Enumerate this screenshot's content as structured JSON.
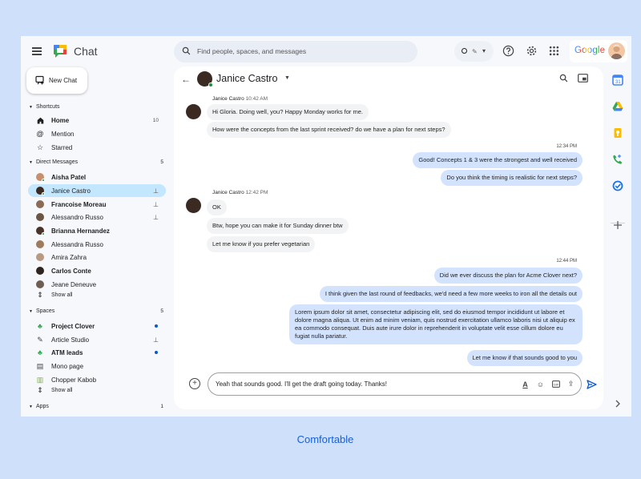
{
  "app": {
    "brand": "Chat"
  },
  "header": {
    "search_placeholder": "Find people, spaces, and messages",
    "google_label": "Google"
  },
  "sidebar": {
    "new_chat": "New Chat",
    "shortcuts": {
      "title": "Shortcuts",
      "items": [
        {
          "label": "Home",
          "count": "10",
          "icon": "home-icon",
          "bold": true
        },
        {
          "label": "Mention",
          "icon": "at-icon"
        },
        {
          "label": "Starred",
          "icon": "star-icon"
        }
      ]
    },
    "direct_messages": {
      "title": "Direct Messages",
      "count": "5",
      "items": [
        {
          "label": "Aisha Patel",
          "bold": true,
          "color": "#c98e6b",
          "presence": true
        },
        {
          "label": "Janice Castro",
          "active": true,
          "pinned": true,
          "color": "#3b2a22",
          "presence": true
        },
        {
          "label": "Francoise Moreau",
          "bold": true,
          "pinned": true,
          "color": "#8a6b56"
        },
        {
          "label": "Alessandro Russo",
          "pinned": true,
          "color": "#6b5545"
        },
        {
          "label": "Brianna Hernandez",
          "bold": true,
          "color": "#4a3228",
          "presence": true
        },
        {
          "label": "Alessandra Russo",
          "color": "#a07a5c"
        },
        {
          "label": "Amira Zahra",
          "color": "#b89a82"
        },
        {
          "label": "Carlos Conte",
          "bold": true,
          "color": "#2e2420"
        },
        {
          "label": "Jeane Deneuve",
          "color": "#6f5d52"
        }
      ],
      "show_all": "Show all"
    },
    "spaces": {
      "title": "Spaces",
      "count": "5",
      "items": [
        {
          "label": "Project Clover",
          "bold": true,
          "icon": "clover-icon",
          "unread": true
        },
        {
          "label": "Article Studio",
          "icon": "studio-icon",
          "pinned": true
        },
        {
          "label": "ATM leads",
          "bold": true,
          "icon": "clover-icon",
          "unread": true
        },
        {
          "label": "Mono page",
          "icon": "page-icon"
        },
        {
          "label": "Chopper Kabob",
          "icon": "kabob-icon"
        }
      ],
      "show_all": "Show all"
    },
    "apps": {
      "title": "Apps",
      "count": "1"
    }
  },
  "chat": {
    "contact_name": "Janice Castro",
    "messages": [
      {
        "sender": "Janice Castro",
        "time": "10:42 AM"
      },
      {
        "text": "Hi Gloria. Doing well, you? Happy Monday works for me."
      },
      {
        "text": "How were the concepts from the last sprint received? do we have a plan for next steps?"
      },
      {
        "stamp": "12:34 PM"
      },
      {
        "text": "Good! Concepts 1 & 3 were the strongest and well received"
      },
      {
        "text": "Do you think the timing is realistic for next steps?"
      },
      {
        "sender": "Janice Castro",
        "time": "12:42 PM"
      },
      {
        "text": "OK"
      },
      {
        "text": "Btw, hope you can make it for Sunday dinner btw"
      },
      {
        "text": "Let me know if you prefer vegetarian"
      },
      {
        "stamp": "12:44 PM"
      },
      {
        "text": "Did we ever discuss the plan for Acme Clover next?"
      },
      {
        "text": "I think given the last round of feedbacks, we'd need a few more weeks to iron all the details out"
      },
      {
        "text": "Lorem ipsum dolor sit amet, consectetur adipiscing elit, sed do eiusmod tempor incididunt ut labore et dolore magna aliqua. Ut enim ad minim veniam, quis nostrud exercitation ullamco laboris nisi ut aliquip ex ea commodo consequat. Duis aute irure dolor in reprehenderit in voluptate velit esse cillum dolore eu fugiat nulla pariatur."
      },
      {
        "text": "Let me know if that sounds good to you"
      }
    ],
    "composer_value": "Yeah that sounds good. I'll get the draft going today. Thanks!"
  },
  "caption": "Comfortable",
  "colors": {
    "accent": "#0b57d0",
    "active_bg": "#c2e7ff",
    "outgoing_bubble": "#d3e3fd",
    "incoming_bubble": "#f1f3f4",
    "presence": "#1e8e3e"
  }
}
